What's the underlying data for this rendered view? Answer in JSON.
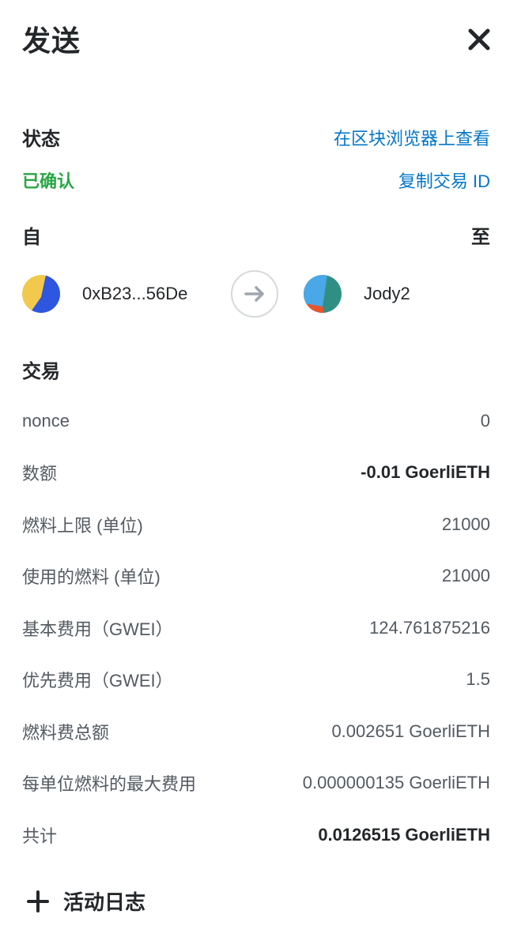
{
  "header": {
    "title": "发送",
    "close_icon": "close-icon"
  },
  "status": {
    "label": "状态",
    "value": "已确认",
    "value_color": "#28a745",
    "view_on_explorer": "在区块浏览器上查看",
    "copy_tx_id": "复制交易 ID"
  },
  "parties": {
    "from_label": "自",
    "to_label": "至",
    "from_address": "0xB23...56De",
    "to_name": "Jody2",
    "arrow_icon": "arrow-right-icon"
  },
  "transaction": {
    "title": "交易",
    "rows": [
      {
        "label": "nonce",
        "value": "0",
        "bold": false
      },
      {
        "label": "数额",
        "value": "-0.01 GoerliETH",
        "bold": true
      },
      {
        "label": "燃料上限 (单位)",
        "value": "21000",
        "bold": false
      },
      {
        "label": "使用的燃料 (单位)",
        "value": "21000",
        "bold": false
      },
      {
        "label": "基本费用（GWEI）",
        "value": "124.761875216",
        "bold": false
      },
      {
        "label": "优先费用（GWEI）",
        "value": "1.5",
        "bold": false
      },
      {
        "label": "燃料费总额",
        "value": "0.002651 GoerliETH",
        "bold": false
      },
      {
        "label": "每单位燃料的最大费用",
        "value": "0.000000135 GoerliETH",
        "bold": false
      },
      {
        "label": "共计",
        "value": "0.0126515 GoerliETH",
        "bold": true
      }
    ]
  },
  "activity_log": {
    "label": "活动日志",
    "icon": "plus-icon"
  },
  "colors": {
    "link": "#0376c9",
    "text": "#24272a",
    "muted": "#535a61",
    "success": "#28a745"
  }
}
